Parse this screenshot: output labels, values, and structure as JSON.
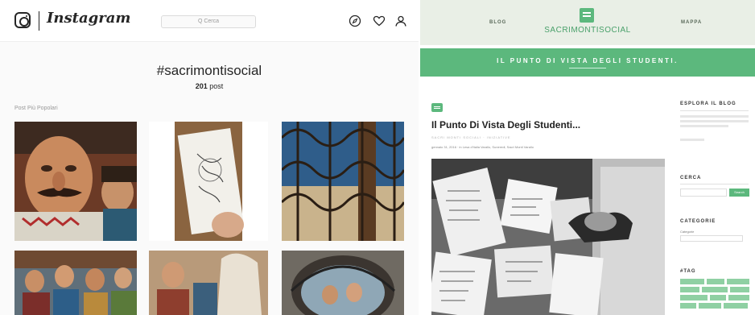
{
  "instagram": {
    "wordmark": "Instagram",
    "search_placeholder": "Q Cerca",
    "hashtag": "#sacrimontisocial",
    "post_count": "201",
    "post_count_label": "post",
    "section_label": "Post Più Popolari",
    "icons": [
      "instagram-camera-icon",
      "explore-compass-icon",
      "heart-icon",
      "profile-icon"
    ]
  },
  "blog": {
    "nav_left": "BLOG",
    "nav_right": "MAPPA",
    "logo_text": "SACRIMONTISOCIAL",
    "banner_title": "IL PUNTO DI VISTA DEGLI STUDENTI.",
    "post": {
      "title": "Il Punto Di Vista Degli Studenti...",
      "category": "SACRI MONTI SOCIALI · INIZIATIVE",
      "date": "gennaio 31, 2016",
      "meta": "in Lesa d'Italia Varallo, Suneredi, Sacri Monti Varallo"
    },
    "sidebar": {
      "explore_heading": "ESPLORA IL BLOG",
      "search_heading": "CERCA",
      "search_button": "Search",
      "categories_heading": "CATEGORIE",
      "categories_label": "Categorie",
      "tags_heading": "#TAG"
    },
    "accent_color": "#5cb87d"
  }
}
